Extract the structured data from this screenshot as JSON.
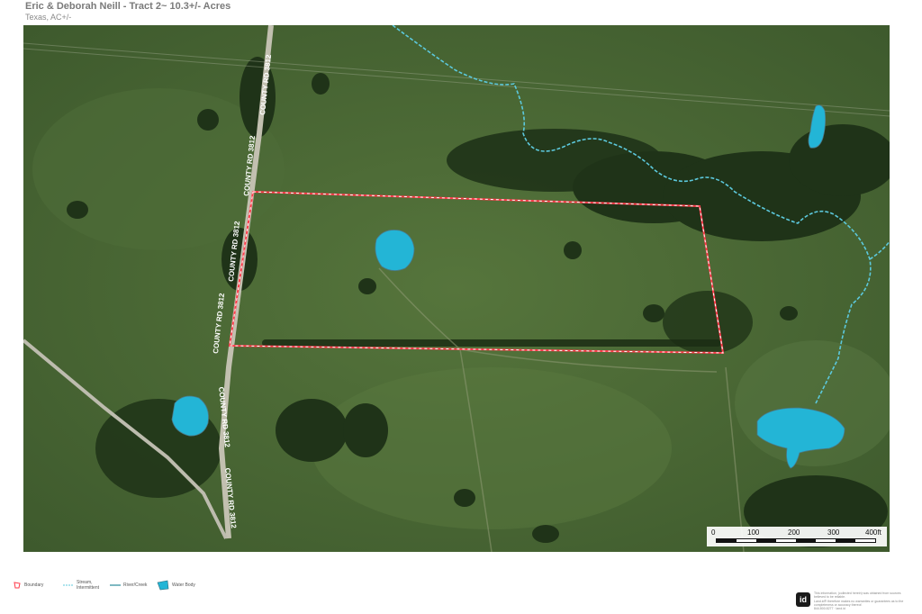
{
  "header": {
    "title": "Eric & Deborah Neill - Tract 2~ 10.3+/- Acres",
    "subtitle": "Texas, AC+/-"
  },
  "map": {
    "road_label": "COUNTY RD 3812",
    "colors": {
      "boundary": "#ff3b4a",
      "water": "#23b5d6",
      "stream": "#5cc8dc",
      "pasture": "#4a6a34",
      "trees": "#1f3318"
    }
  },
  "scale": {
    "ticks": [
      "0",
      "100",
      "200",
      "300",
      "400ft"
    ]
  },
  "legend": {
    "boundary": "Boundary",
    "stream_line1": "Stream,",
    "stream_line2": "Intermittent",
    "river": "River/Creek",
    "water": "Water Body"
  },
  "footer": {
    "logo": "id",
    "disclaimer_lines": [
      "This information, (collected herein) was obtained from sources",
      "believed to be reliable.",
      "Land.id® therefore makes no warranties or guarantees as to the",
      "completeness or accuracy thereof.",
      "844.800.8277 · land.id"
    ]
  }
}
